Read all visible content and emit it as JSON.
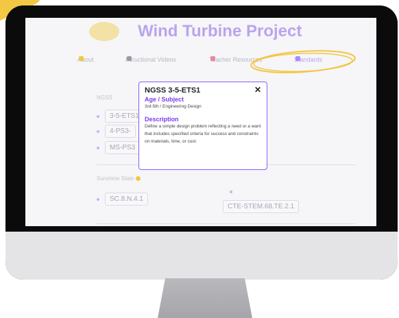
{
  "page": {
    "title": "Wind Turbine Project",
    "nav": [
      {
        "label": "About"
      },
      {
        "label": "Intructional Videos"
      },
      {
        "label": "Teacher Resources"
      },
      {
        "label": "Standards"
      }
    ]
  },
  "sections": {
    "ngss": {
      "label": "NGSS",
      "items": [
        "3-5-ETS1",
        "4-PS3-",
        "MS-PS3"
      ]
    },
    "sunshine": {
      "label": "Sunshine State",
      "items": [
        "SC.8.N.4.1",
        "CTE-STEM.68.TE.2.1"
      ]
    }
  },
  "popup": {
    "title": "NGSS 3-5-ETS1",
    "close": "✕",
    "age_heading": "Age / Subject",
    "age_text": "3rd-5th / Engineering Design",
    "desc_heading": "Description",
    "desc_text": "Define a simple design problem reflecting a need or a want that includes specified criteria for success and constraints on materials, time, or cost."
  },
  "colors": {
    "accent": "#8b5cf6",
    "title_lavender": "#b9a5ee",
    "highlight_yellow": "#f2c744",
    "monitor": "#0b0b0b"
  }
}
